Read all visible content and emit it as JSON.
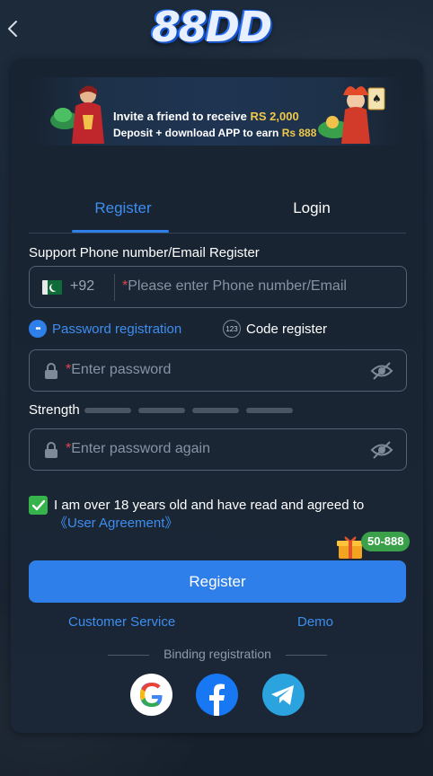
{
  "header": {
    "back_icon": "chevron-left-icon",
    "logo_text": "88DD"
  },
  "banner": {
    "line1_prefix": "Invite a friend to receive",
    "line1_amount": "RS 2,000",
    "line2_prefix": "Deposit + download APP to earn",
    "line2_amount": "Rs 888"
  },
  "tabs": [
    {
      "label": "Register",
      "active": true
    },
    {
      "label": "Login",
      "active": false
    }
  ],
  "form": {
    "support_label": "Support Phone number/Email Register",
    "country_code": "+92",
    "phone_placeholder": "Please enter Phone number/Email",
    "mode_password": "Password registration",
    "mode_code": "Code register",
    "password_placeholder": "Enter password",
    "strength_label": "Strength",
    "password_again_placeholder": "Enter password again",
    "required_mark": "*",
    "agree_text": "I am over 18 years old and have read and agreed to ",
    "agree_link": "《User Agreement》",
    "agree_checked": true
  },
  "gift_badge": {
    "text": "50-888",
    "icon": "gift-icon"
  },
  "register_button": "Register",
  "links": {
    "customer_service": "Customer Service",
    "demo": "Demo"
  },
  "binding": {
    "label": "Binding registration",
    "providers": [
      "google-icon",
      "facebook-icon",
      "telegram-icon"
    ]
  },
  "colors": {
    "accent": "#2e7fe9",
    "background": "#1a2634",
    "check": "#36b34a",
    "highlight": "#f0c84a"
  }
}
